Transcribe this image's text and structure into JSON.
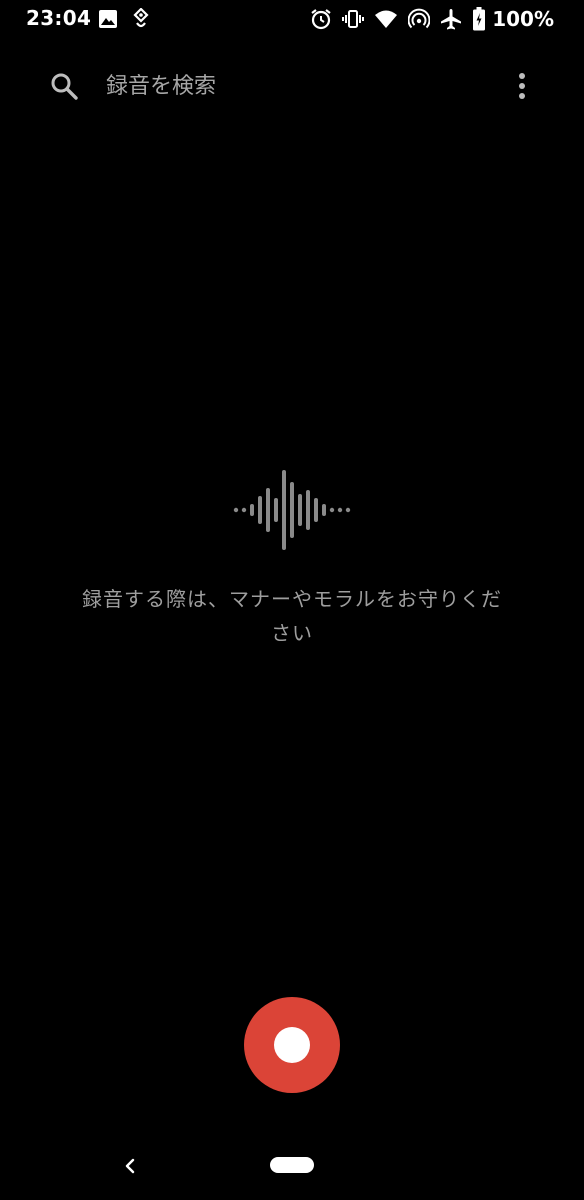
{
  "status_bar": {
    "time": "23:04",
    "left_icons": [
      "image-icon",
      "location-heart-icon"
    ],
    "right_icons": [
      "alarm-icon",
      "vibrate-icon",
      "wifi-icon",
      "hotspot-icon",
      "airplane-icon",
      "battery-charging-icon"
    ],
    "battery_text": "100%"
  },
  "search": {
    "placeholder": "録音を検索",
    "value": "",
    "icon": "search-icon",
    "menu_icon": "more-vert-icon"
  },
  "empty_state": {
    "icon": "waveform-icon",
    "message": "録音する際は、マナーやモラルをお守りください"
  },
  "record": {
    "icon": "record-icon",
    "color": "#db4437"
  },
  "nav": {
    "back_icon": "back-icon",
    "home_icon": "home-pill-icon"
  },
  "colors": {
    "background": "#000000",
    "text_secondary": "#9e9e9e",
    "waveform": "#8a8a8a",
    "accent_record": "#db4437"
  }
}
